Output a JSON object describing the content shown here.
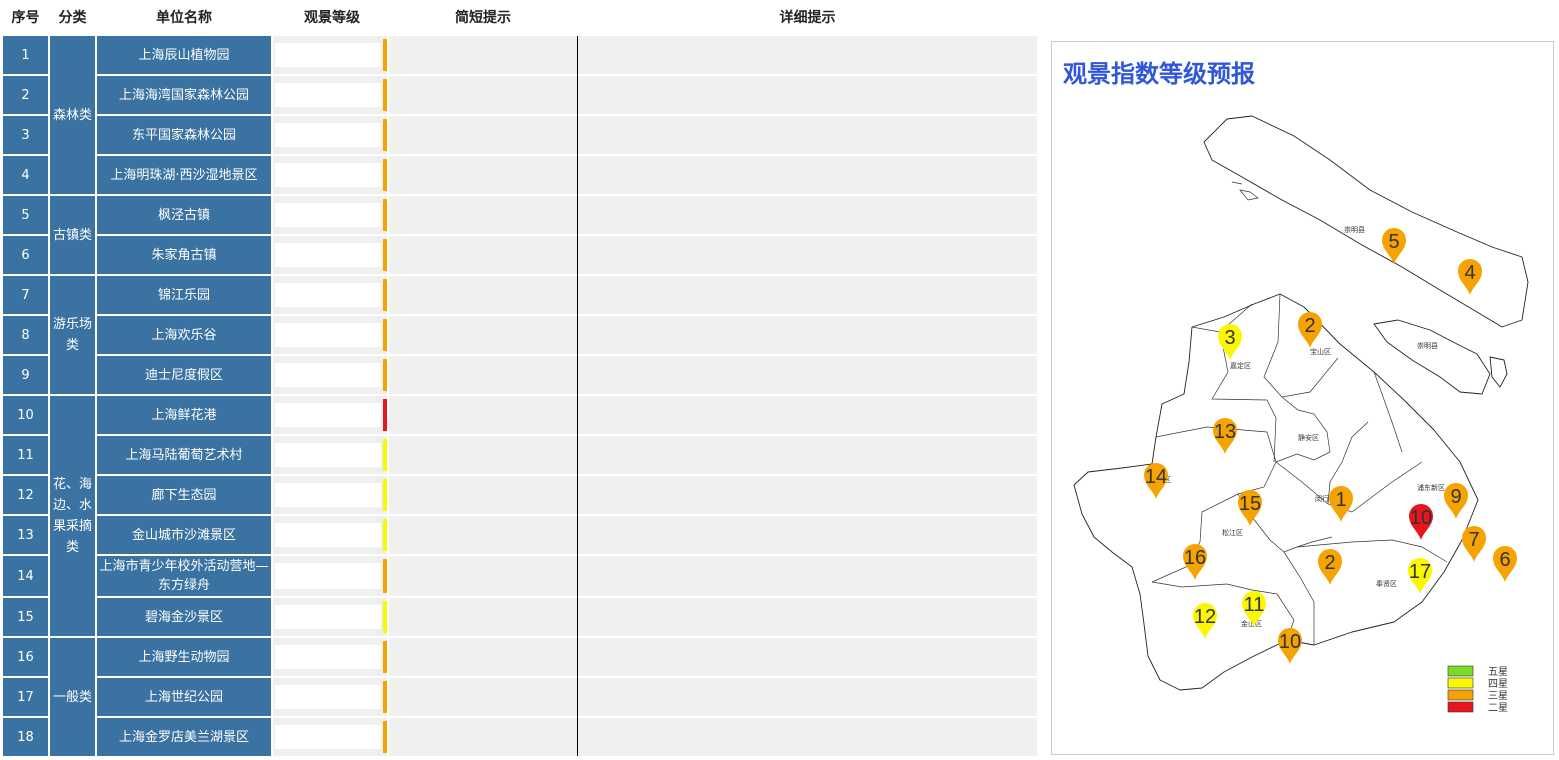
{
  "header": {
    "seq": "序号",
    "category": "分类",
    "unit_name": "单位名称",
    "grade": "观景等级",
    "brief": "简短提示",
    "detail": "详细提示"
  },
  "colors": {
    "cell_blue": "#3a72a2",
    "grade_three": "#f5a300",
    "grade_four": "#fbf700",
    "grade_two": "#e7151d",
    "grade_five": "#7bdc25",
    "title_blue": "#2f56dd"
  },
  "rows": [
    {
      "seq": "1",
      "name": "上海辰山植物园",
      "grade": "三星"
    },
    {
      "seq": "2",
      "name": "上海海湾国家森林公园",
      "grade": "三星"
    },
    {
      "seq": "3",
      "name": "东平国家森林公园",
      "grade": "三星"
    },
    {
      "seq": "4",
      "name": "上海明珠湖·西沙湿地景区",
      "grade": "三星"
    },
    {
      "seq": "5",
      "name": "枫泾古镇",
      "grade": "三星"
    },
    {
      "seq": "6",
      "name": "朱家角古镇",
      "grade": "三星"
    },
    {
      "seq": "7",
      "name": "锦江乐园",
      "grade": "三星"
    },
    {
      "seq": "8",
      "name": "上海欢乐谷",
      "grade": "三星"
    },
    {
      "seq": "9",
      "name": "迪士尼度假区",
      "grade": "三星"
    },
    {
      "seq": "10",
      "name": "上海鲜花港",
      "grade": "二星"
    },
    {
      "seq": "11",
      "name": "上海马陆葡萄艺术村",
      "grade": "四星"
    },
    {
      "seq": "12",
      "name": "廊下生态园",
      "grade": "四星"
    },
    {
      "seq": "13",
      "name": "金山城市沙滩景区",
      "grade": "四星"
    },
    {
      "seq": "14",
      "name": "上海市青少年校外活动营地—东方绿舟",
      "grade": "三星"
    },
    {
      "seq": "15",
      "name": "碧海金沙景区",
      "grade": "四星"
    },
    {
      "seq": "16",
      "name": "上海野生动物园",
      "grade": "三星"
    },
    {
      "seq": "17",
      "name": "上海世纪公园",
      "grade": "三星"
    },
    {
      "seq": "18",
      "name": "上海金罗店美兰湖景区",
      "grade": "三星"
    }
  ],
  "categories": [
    {
      "label": "森林类"
    },
    {
      "label": "古镇类"
    },
    {
      "label": "游乐场类"
    },
    {
      "label": "花、海边、水果采摘类"
    },
    {
      "label": "一般类"
    }
  ],
  "map": {
    "title": "观景指数等级预报",
    "districts": [
      "崇明县",
      "崇明县",
      "嘉定区",
      "宝山区",
      "静安区",
      "闵行区",
      "浦东新区",
      "松江区",
      "奉贤区",
      "金山区",
      "青浦区"
    ],
    "markers": [
      {
        "label": "5",
        "grade": "三星"
      },
      {
        "label": "4",
        "grade": "三星"
      },
      {
        "label": "3",
        "grade": "四星"
      },
      {
        "label": "2",
        "grade": "三星"
      },
      {
        "label": "13",
        "grade": "三星"
      },
      {
        "label": "14",
        "grade": "三星"
      },
      {
        "label": "1",
        "grade": "三星"
      },
      {
        "label": "9",
        "grade": "三星"
      },
      {
        "label": "15",
        "grade": "三星"
      },
      {
        "label": "10",
        "grade": "二星"
      },
      {
        "label": "7",
        "grade": "三星"
      },
      {
        "label": "6",
        "grade": "三星"
      },
      {
        "label": "16",
        "grade": "三星"
      },
      {
        "label": "2",
        "grade": "三星"
      },
      {
        "label": "17",
        "grade": "四星"
      },
      {
        "label": "11",
        "grade": "四星"
      },
      {
        "label": "12",
        "grade": "四星"
      },
      {
        "label": "10",
        "grade": "三星"
      }
    ],
    "legend": [
      {
        "label": "五星",
        "color": "#7bdc25"
      },
      {
        "label": "四星",
        "color": "#fbf700"
      },
      {
        "label": "三星",
        "color": "#f5a300"
      },
      {
        "label": "二星",
        "color": "#e7151d"
      }
    ]
  }
}
